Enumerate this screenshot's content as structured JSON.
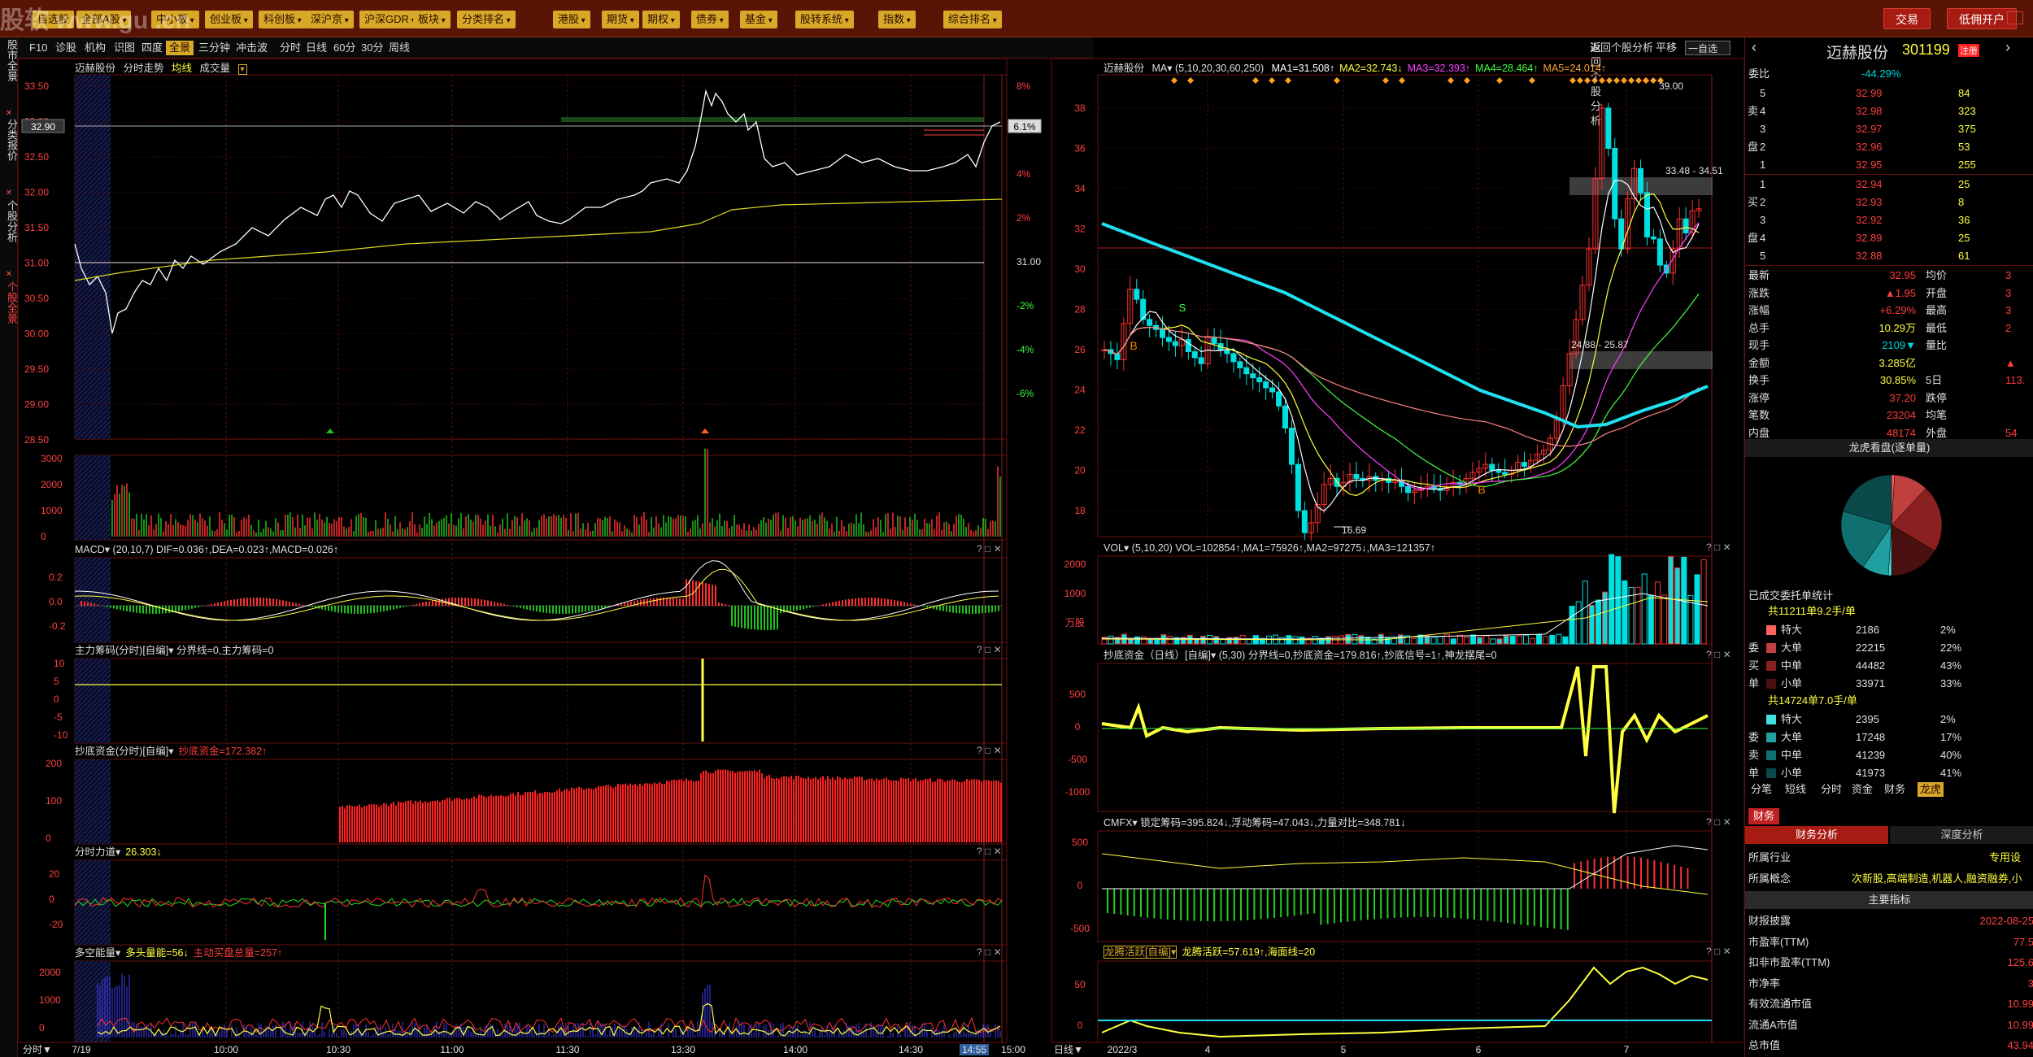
{
  "topbar": {
    "left_tab_partial": "自选股",
    "nav": [
      "全部A股",
      "中小板",
      "创业板",
      "科创板",
      "深沪京",
      "沪深GDR",
      "板块",
      "分类排名",
      "港股",
      "期货",
      "期权",
      "债券",
      "基金",
      "股转系统",
      "指数",
      "综合排名"
    ],
    "trade_button": "交易",
    "margin_button": "低佣开户",
    "watermark": "股软 www.gu    .cn"
  },
  "side_tabs": [
    "股市全景",
    "分类报价",
    "个股分析",
    "个股全景"
  ],
  "subbar": {
    "tabs": [
      "F10",
      "诊股",
      "机构",
      "识图",
      "四度",
      "全景",
      "三分钟",
      "冲击波",
      "分时",
      "日线",
      "60分",
      "30分",
      "周线"
    ],
    "active_tab": "全景",
    "right_link": "返回个股分析",
    "right_flat": "平移",
    "right_select": "一自选"
  },
  "left": {
    "intraday_header": [
      "迈赫股份",
      "分时走势",
      "均线",
      "成交量"
    ],
    "price_ticks": [
      "33.50",
      "33.00",
      "32.50",
      "32.00",
      "31.50",
      "31.00",
      "30.50",
      "30.00",
      "29.50",
      "29.00",
      "28.50"
    ],
    "pct_ticks": [
      "8%",
      "6%",
      "4%",
      "2%",
      "31.00",
      "-2%",
      "-4%",
      "-6%"
    ],
    "current_price_tag": "32.90",
    "current_pct_tag": "6.1%",
    "vol_ticks": [
      "3000",
      "2000",
      "1000",
      "0"
    ],
    "macd_header": "MACD▾ (20,10,7) DIF=0.036↑,DEA=0.023↑,MACD=0.026↑",
    "macd_ticks": [
      "0.2",
      "0.0",
      "-0.2"
    ],
    "main_header": "主力筹码(分时)[自编]▾ 分界线=0,主力筹码=0",
    "main_ticks": [
      "10",
      "5",
      "0",
      "-5",
      "-10"
    ],
    "bottom_fund_header_a": "抄底资金(分时)[自编]▾",
    "bottom_fund_header_b": "抄底资金=172.382↑",
    "bottom_fund_ticks": [
      "200",
      "100",
      "0"
    ],
    "force_header": "分时力道▾",
    "force_value": "26.303↓",
    "force_ticks": [
      "20",
      "0",
      "-20"
    ],
    "energy_header": "多空能量▾",
    "energy_long": "多头量能=56↓",
    "energy_short": "主动买盘总量=257↑",
    "energy_ticks": [
      "2000",
      "1000",
      "0"
    ],
    "time_axis": [
      "7/19",
      "10:00",
      "10:30",
      "11:00",
      "11:30",
      "13:30",
      "14:00",
      "14:30",
      "14:55",
      "15:00"
    ],
    "time_axis_tab": "分时▼"
  },
  "middle": {
    "kline_header_name": "迈赫股份",
    "kline_header": "MA▾ (5,10,20,30,60,250)",
    "ma_values": [
      "MA1=31.508↑",
      "MA2=32.743↓",
      "MA3=32.393↑",
      "MA4=28.464↑",
      "MA5=24.014↑"
    ],
    "ma_colors": [
      "#ffffff",
      "#ffff40",
      "#ff40ff",
      "#40ff40",
      "#ffa030"
    ],
    "price_ticks": [
      "38",
      "36",
      "34",
      "32",
      "30",
      "28",
      "26",
      "24",
      "22",
      "20",
      "18"
    ],
    "annotations": [
      "39.00",
      "33.48 - 34.51",
      "24.88 - 25.87",
      "16.69"
    ],
    "vol_header": "VOL▾ (5,10,20) VOL=102854↑,MA1=75926↑,MA2=97275↓,MA3=121357↑",
    "vol_ticks": [
      "2000",
      "1000",
      "万股"
    ],
    "fund_header": "抄底资金（日线）[自编]▾ (5,30) 分界线=0,抄底资金=179.816↑,抄底信号=1↑,神龙摆尾=0",
    "fund_ticks": [
      "500",
      "0",
      "-500",
      "-1000"
    ],
    "cmfx_header": "CMFX▾ 锁定筹码=395.824↓,浮动筹码=47.043↓,力量对比=348.781↓",
    "cmfx_ticks": [
      "500",
      "0",
      "-500"
    ],
    "dragon_header_a": "龙腾活跃[自编]▾",
    "dragon_header_b": "龙腾活跃=57.619↑,海面线=20",
    "dragon_ticks": [
      "50",
      "0"
    ],
    "date_axis": [
      "2022/3",
      "4",
      "5",
      "6",
      "7"
    ],
    "date_axis_tab": "日线▼"
  },
  "right": {
    "name": "迈赫股份",
    "code": "301199",
    "tag": "注册",
    "weibi_label": "委比",
    "weibi_value": "-44.29%",
    "asks": [
      {
        "lvl": "5",
        "price": "32.99",
        "vol": "84"
      },
      {
        "lvl": "4",
        "price": "32.98",
        "vol": "323"
      },
      {
        "lvl": "3",
        "price": "32.97",
        "vol": "375"
      },
      {
        "lvl": "2",
        "price": "32.96",
        "vol": "53"
      },
      {
        "lvl": "1",
        "price": "32.95",
        "vol": "255"
      }
    ],
    "bids": [
      {
        "lvl": "1",
        "price": "32.94",
        "vol": "25"
      },
      {
        "lvl": "2",
        "price": "32.93",
        "vol": "8"
      },
      {
        "lvl": "3",
        "price": "32.92",
        "vol": "36"
      },
      {
        "lvl": "4",
        "price": "32.89",
        "vol": "25"
      },
      {
        "lvl": "5",
        "price": "32.88",
        "vol": "61"
      }
    ],
    "ask_side_chars": [
      "卖",
      "盘"
    ],
    "bid_side_chars": [
      "买",
      "盘"
    ],
    "stats": [
      {
        "l1": "最新",
        "v1": "32.95",
        "l2": "均价",
        "v2": "3"
      },
      {
        "l1": "涨跌",
        "v1": "▲1.95",
        "l2": "开盘",
        "v2": "3"
      },
      {
        "l1": "涨幅",
        "v1": "+6.29%",
        "l2": "最高",
        "v2": "3"
      },
      {
        "l1": "总手",
        "v1": "10.29万",
        "l2": "最低",
        "v2": "2"
      },
      {
        "l1": "现手",
        "v1": "2109▼",
        "l2": "量比",
        "v2": ""
      },
      {
        "l1": "金额",
        "v1": "3.285亿",
        "l2": "",
        "v2": "▲"
      },
      {
        "l1": "换手",
        "v1": "30.85%",
        "l2": "5日",
        "v2": "113."
      },
      {
        "l1": "涨停",
        "v1": "37.20",
        "l2": "跌停",
        "v2": ""
      },
      {
        "l1": "笔数",
        "v1": "23204",
        "l2": "均笔",
        "v2": ""
      },
      {
        "l1": "内盘",
        "v1": "48174",
        "l2": "外盘",
        "v2": "54"
      }
    ],
    "pie_title": "龙虎看盘(逐单量)",
    "pie_slices": [
      {
        "value": 2,
        "color": "#ff6060"
      },
      {
        "value": 22,
        "color": "#c04040"
      },
      {
        "value": 43,
        "color": "#8a2020"
      },
      {
        "value": 33,
        "color": "#4a1010"
      },
      {
        "value": 2,
        "color": "#40e0e0"
      },
      {
        "value": 17,
        "color": "#20a0a0"
      },
      {
        "value": 40,
        "color": "#107070"
      },
      {
        "value": 41,
        "color": "#0a4a4a"
      }
    ],
    "orders_title": "已成交委托单统计",
    "buy_summary": "共11211单9.2手/单",
    "sell_summary": "共14724单7.0手/单",
    "buy_side_chars": [
      "委",
      "买",
      "单"
    ],
    "sell_side_chars": [
      "委",
      "卖",
      "单"
    ],
    "buy_rows": [
      {
        "label": "特大",
        "vol": "2186",
        "pct": "2%",
        "color": "#ff6060"
      },
      {
        "label": "大单",
        "vol": "22215",
        "pct": "22%",
        "color": "#c04040"
      },
      {
        "label": "中单",
        "vol": "44482",
        "pct": "43%",
        "color": "#8a2020"
      },
      {
        "label": "小单",
        "vol": "33971",
        "pct": "33%",
        "color": "#4a1010"
      }
    ],
    "sell_rows": [
      {
        "label": "特大",
        "vol": "2395",
        "pct": "2%",
        "color": "#40e0e0"
      },
      {
        "label": "大单",
        "vol": "17248",
        "pct": "17%",
        "color": "#20a0a0"
      },
      {
        "label": "中单",
        "vol": "41239",
        "pct": "40%",
        "color": "#107070"
      },
      {
        "label": "小单",
        "vol": "41973",
        "pct": "41%",
        "color": "#0a4a4a"
      }
    ],
    "bottom_tabs": [
      "分笔",
      "短线",
      "分时",
      "资金",
      "财务",
      "龙虎"
    ],
    "active_bottom_tab": "龙虎",
    "fin_tab": "财务",
    "fin_subtabs": [
      "财务分析",
      "深度分析"
    ],
    "industry_label": "所属行业",
    "industry_value": "专用设",
    "concept_label": "所属概念",
    "concept_value": "次新股,高端制造,机器人,融资融券,小",
    "main_index_title": "主要指标",
    "fin_rows": [
      {
        "label": "财报披露",
        "value": "2022-08-25"
      },
      {
        "label": "市盈率(TTM)",
        "value": "77.5"
      },
      {
        "label": "扣非市盈率(TTM)",
        "value": "125.6"
      },
      {
        "label": "市净率",
        "value": "3"
      },
      {
        "label": "有效流通市值",
        "value": "10.99"
      },
      {
        "label": "流通A市值",
        "value": "10.99"
      },
      {
        "label": "总市值",
        "value": "43.94"
      }
    ]
  }
}
